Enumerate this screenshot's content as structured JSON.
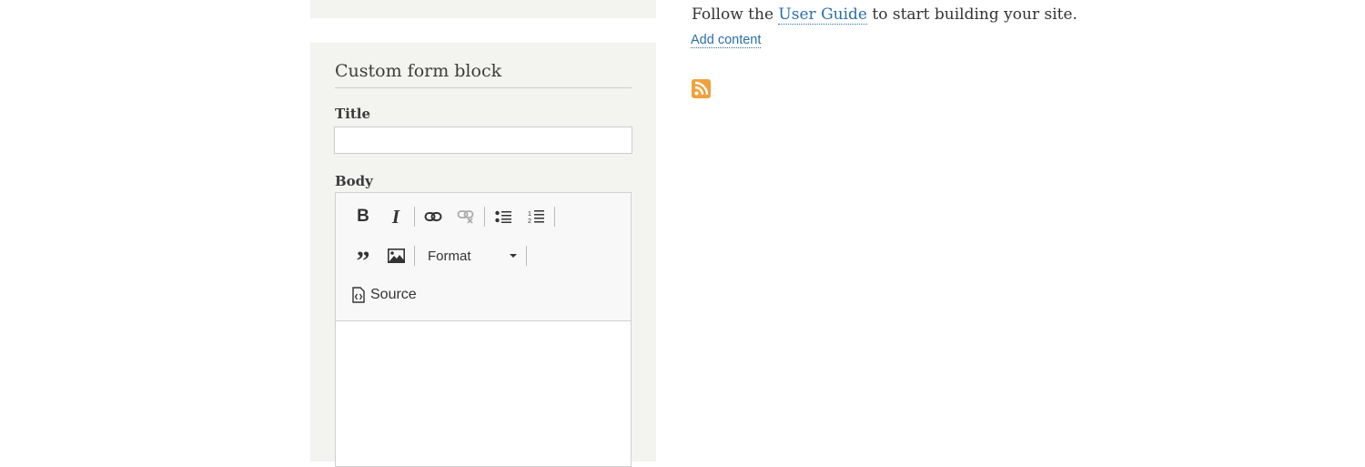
{
  "block": {
    "title": "Custom form block",
    "title_label": "Title",
    "title_value": "",
    "body_label": "Body"
  },
  "editor": {
    "toolbar": {
      "bold_label": "B",
      "italic_label": "I",
      "format_label": "Format",
      "source_label": "Source"
    },
    "icons": [
      "bold-icon",
      "italic-icon",
      "link-icon",
      "unlink-icon",
      "bulleted-list-icon",
      "numbered-list-icon",
      "blockquote-icon",
      "image-icon",
      "source-icon"
    ]
  },
  "main": {
    "text_before": "Follow the ",
    "link_text": "User Guide",
    "text_after": " to start building your site.",
    "add_content": "Add content"
  },
  "colors": {
    "link": "#2b6ea8",
    "rss": "#f0a13c",
    "panel_bg": "#f3f3ef"
  }
}
